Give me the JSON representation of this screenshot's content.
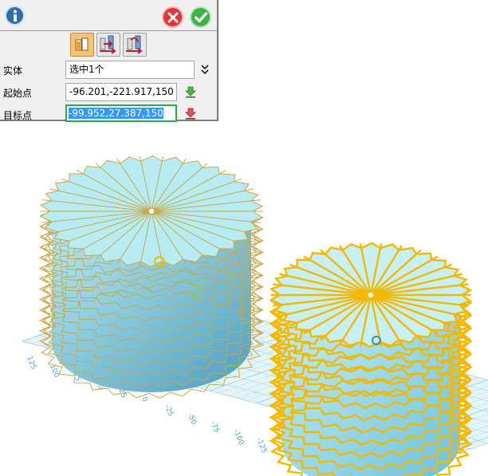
{
  "panel": {
    "mode_buttons": [
      {
        "icon": "select-solid-icon",
        "active": true
      },
      {
        "icon": "translate-move-icon",
        "active": false
      },
      {
        "icon": "rotate-move-icon",
        "active": false
      }
    ],
    "rows": {
      "entity": {
        "label": "实体",
        "value": "选中1个"
      },
      "start_point": {
        "label": "起始点",
        "value": "-96.201,-221.917,150"
      },
      "target_point": {
        "label": "目标点",
        "value": "-99.952,27.387,150"
      }
    }
  },
  "viewport": {
    "axis_labels": [
      "125",
      "100",
      "75",
      "50",
      "25",
      "0",
      "-25",
      "-50",
      "-75",
      "-100",
      "-125"
    ],
    "colors": {
      "solid_fill": "#8fd8e8",
      "blade_edge": "#c8a84a",
      "highlight": "#f5b800",
      "grid": "#8ed0e4",
      "grid_label": "#4ea9c9"
    }
  }
}
